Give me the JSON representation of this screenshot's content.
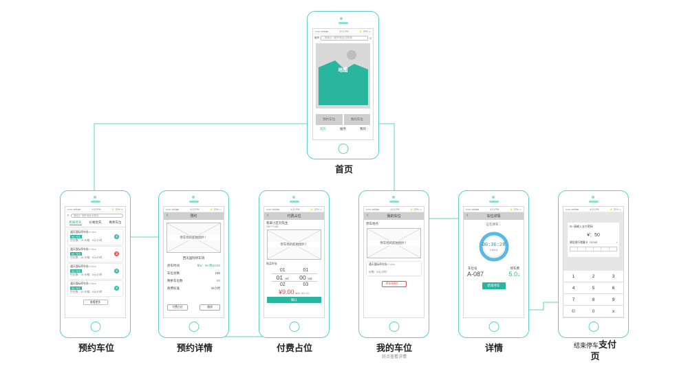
{
  "status": {
    "carrier": "•••••• cellular",
    "time": "4:21 PM",
    "battery": "⚡ 22% ▭"
  },
  "home": {
    "caption": "首页",
    "search_placeholder": "搜地点 / 城市/地址/目的地",
    "search_left": "城市",
    "map_label": "地图",
    "btn_reserve": "预约车位",
    "btn_mycar": "我的车位",
    "tabs": [
      "首页",
      "服务",
      "我的"
    ]
  },
  "list": {
    "caption": "预约车位",
    "search": "搜地点 / 城市/地址/目的地",
    "tabs": [
      "距离优先",
      "价格优先",
      "剩余车位"
    ],
    "items": [
      {
        "name": "通天国际停车场",
        "dist": "0.4km",
        "tag": "地上车位",
        "info": "空位数：15 价格：5元/小时",
        "icon": "停",
        "red": false
      },
      {
        "name": "通天国际停车场",
        "dist": "0.5km",
        "tag": "地上车位",
        "info": "空位数：15 价格：5元/小时",
        "icon": "满",
        "red": true
      },
      {
        "name": "通天国际停车场",
        "dist": "0.6km",
        "tag": "地上车位",
        "info": "空位数：15 价格：5元/小时",
        "icon": "停",
        "red": false
      },
      {
        "name": "通天国际停车场",
        "dist": "0.8km",
        "tag": "地上车位",
        "info": "空位数：15 价格：5元/小时",
        "icon": "停",
        "red": false
      }
    ],
    "more": "查看更多"
  },
  "reserve": {
    "caption": "预约详情",
    "title": "预约",
    "photo": "停车场的航拍图片！",
    "name": "西天国际停车场",
    "rows": [
      {
        "k": "停车时间",
        "v": "早6：30-晚23:50"
      },
      {
        "k": "车位总数",
        "v": "150"
      },
      {
        "k": "剩余车位数",
        "v": "80"
      },
      {
        "k": "收费标准",
        "v": "5/小时"
      }
    ],
    "btn_left": "付费占位",
    "btn_right": "路线"
  },
  "pay": {
    "caption": "付费占位",
    "title": "付费占位",
    "place": "翡翠小区刘先生",
    "phone": "186****1485",
    "photo": "停车场的航拍图片！",
    "duration_label": "购买时长",
    "picker": [
      [
        "01",
        "01"
      ],
      [
        "01",
        "00"
      ],
      [
        "02",
        "03"
      ]
    ],
    "unit_h": "小时",
    "unit_m": "分钟",
    "price": "¥9.00",
    "price_note": "(每半小时1.5元)",
    "submit": "确认"
  },
  "mycar": {
    "caption": "我的车位",
    "sub": "轻点查看详情",
    "title": "我的车位",
    "label": "停车地点",
    "photo": "停车场的航拍图片！",
    "lot": "通天国际停车场",
    "dist": "0.4km",
    "info": "价格：5元/小时",
    "btn": "停车场图片 →"
  },
  "detail": {
    "caption": "详情",
    "title": "车位详情",
    "state": "正在停车...",
    "timer": "00:36:28",
    "timer_sub": "已停时长",
    "spot_label": "车位号",
    "spot": "A-087",
    "fee_label": "停车费",
    "fee": "5.0",
    "fee_unit": "元",
    "end": "结束停车"
  },
  "payment": {
    "caption": "结束停车支付页",
    "caption_a": "结束停车",
    "caption_b": "支付",
    "caption_c": "页",
    "prompt": "⊡• 请输入支付密码",
    "amount": "¥：50",
    "card": "建设银行储蓄卡（1234）",
    "keys": [
      "1",
      "2",
      "3",
      "4",
      "5",
      "6",
      "7",
      "8",
      "9",
      "©",
      "0",
      "x"
    ]
  },
  "colors": {
    "accent": "#2ab59f",
    "frame": "#5cd0c0",
    "line": "#5cd0c0",
    "red": "#e84545"
  }
}
